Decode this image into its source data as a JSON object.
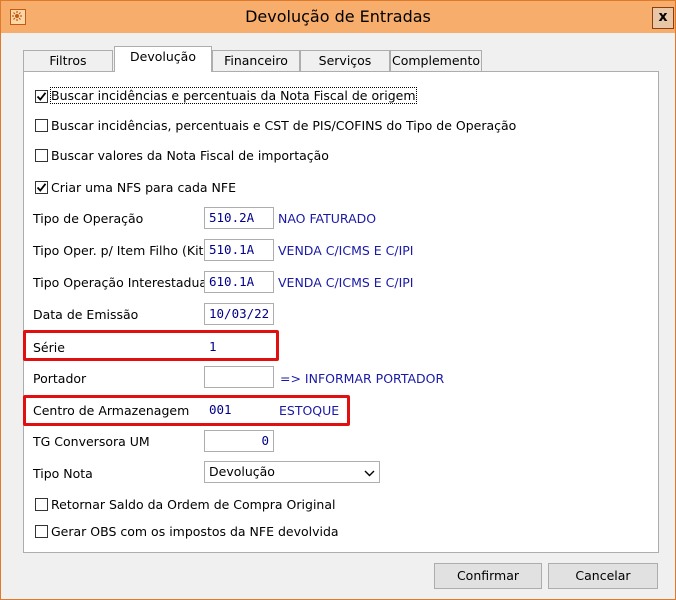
{
  "window": {
    "title": "Devolução de Entradas",
    "close_label": "x"
  },
  "tabs": [
    {
      "label": "Filtros",
      "active": false
    },
    {
      "label": "Devolução",
      "active": true
    },
    {
      "label": "Financeiro",
      "active": false
    },
    {
      "label": "Serviços",
      "active": false
    },
    {
      "label": "Complemento",
      "active": false
    }
  ],
  "checkboxes": [
    {
      "label": "Buscar incidências e percentuais da Nota Fiscal de origem",
      "checked": true
    },
    {
      "label": "Buscar incidências, percentuais e CST de PIS/COFINS do Tipo de Operação",
      "checked": false
    },
    {
      "label": "Buscar valores da Nota Fiscal de importação",
      "checked": false
    },
    {
      "label": "Criar uma NFS para cada NFE",
      "checked": true
    }
  ],
  "fields": {
    "tipo_operacao": {
      "label": "Tipo de Operação",
      "value": "510.2A",
      "desc": "NAO FATURADO"
    },
    "tipo_oper_item_filho": {
      "label": "Tipo Oper. p/ Item Filho (Kit)",
      "value": "510.1A",
      "desc": "VENDA C/ICMS E C/IPI"
    },
    "tipo_operacao_interestadual": {
      "label": "Tipo Operação Interestadual",
      "value": "610.1A",
      "desc": "VENDA C/ICMS E C/IPI"
    },
    "data_emissao": {
      "label": "Data de Emissão",
      "value": "10/03/22"
    },
    "serie": {
      "label": "Série",
      "value": "1"
    },
    "portador": {
      "label": "Portador",
      "value": "",
      "desc": "=> INFORMAR PORTADOR"
    },
    "centro_armazenagem": {
      "label": "Centro de Armazenagem",
      "value": "001",
      "desc": "ESTOQUE"
    },
    "tg_conversora": {
      "label": "TG Conversora UM",
      "value": "0"
    },
    "tipo_nota": {
      "label": "Tipo Nota",
      "value": "Devolução"
    }
  },
  "bottom_checkboxes": [
    {
      "label": "Retornar Saldo da Ordem de Compra Original",
      "checked": false
    },
    {
      "label": "Gerar OBS com os impostos da NFE devolvida",
      "checked": false
    }
  ],
  "buttons": {
    "confirm_label": "Confirmar",
    "cancel_label": "Cancelar"
  },
  "colors": {
    "titlebar": "#f7ad6b",
    "highlight_box": "#e01010",
    "field_text": "#00008b",
    "desc_text": "#1a1aa6"
  }
}
